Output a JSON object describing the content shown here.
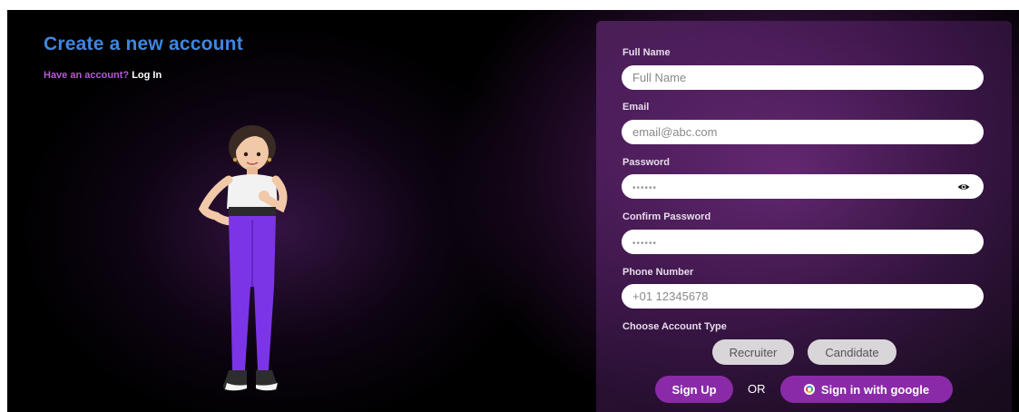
{
  "page": {
    "title": "Create a new account",
    "have_account_text": "Have an account?",
    "login_link": "Log In"
  },
  "form": {
    "full_name": {
      "label": "Full Name",
      "placeholder": "Full Name",
      "value": ""
    },
    "email": {
      "label": "Email",
      "placeholder": "email@abc.com",
      "value": ""
    },
    "password": {
      "label": "Password",
      "placeholder": "••••••",
      "value": "",
      "icon": "eye-icon"
    },
    "confirm_password": {
      "label": "Confirm Password",
      "placeholder": "••••••",
      "value": ""
    },
    "phone": {
      "label": "Phone Number",
      "placeholder": "+01 12345678",
      "value": ""
    },
    "account_type": {
      "label": "Choose Account Type",
      "options": [
        "Recruiter",
        "Candidate"
      ]
    },
    "signup_label": "Sign Up",
    "or_text": "OR",
    "google_label": "Sign in with google"
  },
  "colors": {
    "title": "#3f86e0",
    "accent": "#8a2aa8",
    "link": "#b45ad6",
    "background": "#000000"
  }
}
